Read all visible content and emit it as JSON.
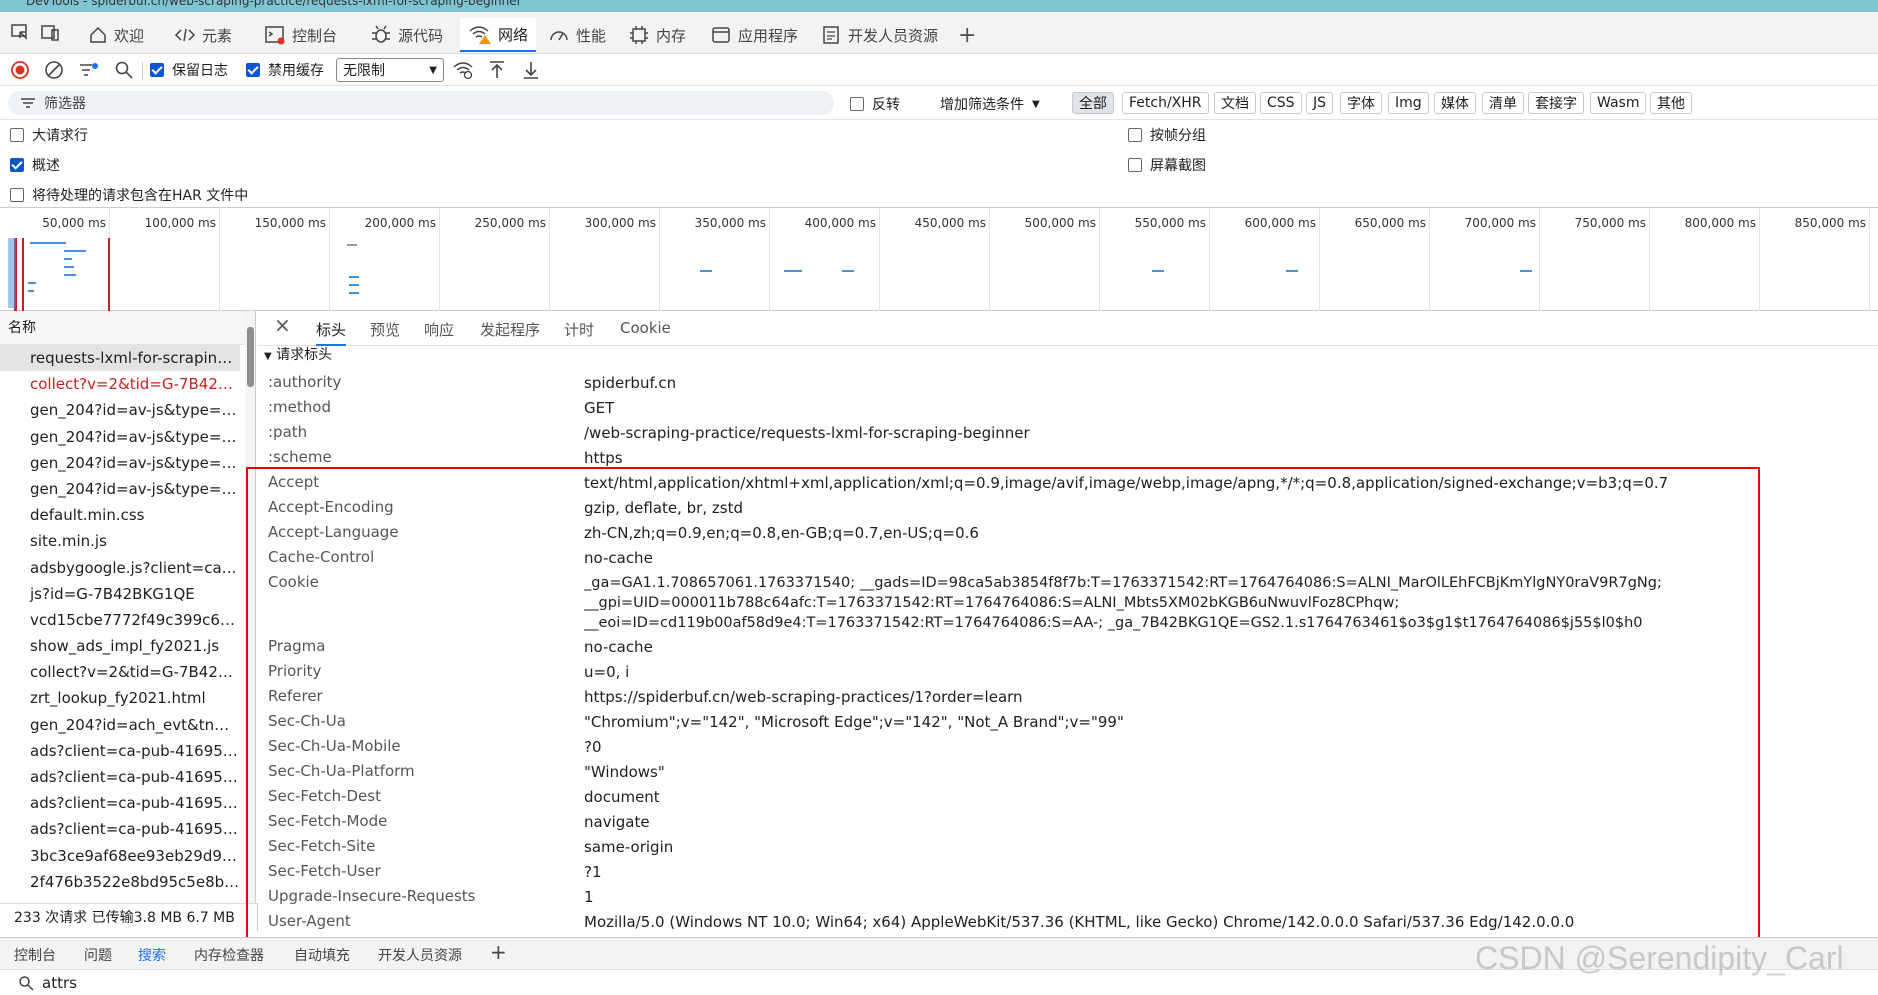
{
  "window": {
    "title": "DevTools - spiderbuf.cn/web-scraping-practice/requests-lxml-for-scraping-beginner"
  },
  "tabs": [
    "欢迎",
    "元素",
    "控制台",
    "源代码",
    "网络",
    "性能",
    "内存",
    "应用程序",
    "开发人员资源"
  ],
  "toolbar": {
    "preserve_log": "保留日志",
    "disable_cache": "禁用缓存",
    "throttle": "无限制"
  },
  "filter": {
    "placeholder": "筛选器",
    "invert": "反转",
    "more_filters": "增加筛选条件",
    "types": [
      "全部",
      "Fetch/XHR",
      "文档",
      "CSS",
      "JS",
      "字体",
      "Img",
      "媒体",
      "清单",
      "套接字",
      "Wasm",
      "其他"
    ]
  },
  "options": {
    "big_rows": "大请求行",
    "overview": "概述",
    "har": "将待处理的请求包含在HAR 文件中",
    "group_frame": "按帧分组",
    "screenshots": "屏幕截图"
  },
  "timeline_ticks": [
    "50,000 ms",
    "100,000 ms",
    "150,000 ms",
    "200,000 ms",
    "250,000 ms",
    "300,000 ms",
    "350,000 ms",
    "400,000 ms",
    "450,000 ms",
    "500,000 ms",
    "550,000 ms",
    "600,000 ms",
    "650,000 ms",
    "700,000 ms",
    "750,000 ms",
    "800,000 ms",
    "850,000 ms"
  ],
  "requests": {
    "header": "名称",
    "items": [
      "requests-lxml-for-scraping...",
      "collect?v=2&tid=G-7B42B...",
      "gen_204?id=av-js&type=fl...",
      "gen_204?id=av-js&type=fl...",
      "gen_204?id=av-js&type=fl...",
      "gen_204?id=av-js&type=fl...",
      "default.min.css",
      "site.min.js",
      "adsbygoogle.js?client=ca-...",
      "js?id=G-7B42BKG1QE",
      "vcd15cbe7772f49c399c6a5...",
      "show_ads_impl_fy2021.js",
      "collect?v=2&tid=G-7B42B...",
      "zrt_lookup_fy2021.html",
      "gen_204?id=ach_evt&tn=...",
      "ads?client=ca-pub-416950...",
      "ads?client=ca-pub-416950...",
      "ads?client=ca-pub-416950...",
      "ads?client=ca-pub-416950...",
      "3bc3ce9af68ee93eb29d97...",
      "2f476b3522e8bd95c5e8ba..."
    ],
    "status": "233 次请求  已传输3.8 MB  6.7 MB"
  },
  "detail": {
    "tabs": [
      "标头",
      "预览",
      "响应",
      "发起程序",
      "计时",
      "Cookie"
    ],
    "section": "请求标头",
    "headers": [
      {
        "k": ":authority",
        "v": "spiderbuf.cn"
      },
      {
        "k": ":method",
        "v": "GET"
      },
      {
        "k": ":path",
        "v": "/web-scraping-practice/requests-lxml-for-scraping-beginner"
      },
      {
        "k": ":scheme",
        "v": "https"
      },
      {
        "k": "Accept",
        "v": "text/html,application/xhtml+xml,application/xml;q=0.9,image/avif,image/webp,image/apng,*/*;q=0.8,application/signed-exchange;v=b3;q=0.7"
      },
      {
        "k": "Accept-Encoding",
        "v": "gzip, deflate, br, zstd"
      },
      {
        "k": "Accept-Language",
        "v": "zh-CN,zh;q=0.9,en;q=0.8,en-GB;q=0.7,en-US;q=0.6"
      },
      {
        "k": "Cache-Control",
        "v": "no-cache"
      },
      {
        "k": "Cookie",
        "v": "_ga=GA1.1.708657061.1763371540; __gads=ID=98ca5ab3854f8f7b:T=1763371542:RT=1764764086:S=ALNI_MarOlLEhFCBjKmYlgNY0raV9R7gNg; __gpi=UID=000011b788c64afc:T=1763371542:RT=1764764086:S=ALNI_Mbts5XM02bKGB6uNwuvlFoz8CPhqw; __eoi=ID=cd119b00af58d9e4:T=1763371542:RT=1764764086:S=AA-; _ga_7B42BKG1QE=GS2.1.s1764763461$o3$g1$t1764764086$j55$l0$h0"
      },
      {
        "k": "Pragma",
        "v": "no-cache"
      },
      {
        "k": "Priority",
        "v": "u=0, i"
      },
      {
        "k": "Referer",
        "v": "https://spiderbuf.cn/web-scraping-practices/1?order=learn"
      },
      {
        "k": "Sec-Ch-Ua",
        "v": "\"Chromium\";v=\"142\", \"Microsoft Edge\";v=\"142\", \"Not_A Brand\";v=\"99\""
      },
      {
        "k": "Sec-Ch-Ua-Mobile",
        "v": "?0"
      },
      {
        "k": "Sec-Ch-Ua-Platform",
        "v": "\"Windows\""
      },
      {
        "k": "Sec-Fetch-Dest",
        "v": "document"
      },
      {
        "k": "Sec-Fetch-Mode",
        "v": "navigate"
      },
      {
        "k": "Sec-Fetch-Site",
        "v": "same-origin"
      },
      {
        "k": "Sec-Fetch-User",
        "v": "?1"
      },
      {
        "k": "Upgrade-Insecure-Requests",
        "v": "1"
      },
      {
        "k": "User-Agent",
        "v": "Mozilla/5.0 (Windows NT 10.0; Win64; x64) AppleWebKit/537.36 (KHTML, like Gecko) Chrome/142.0.0.0 Safari/537.36 Edg/142.0.0.0"
      }
    ]
  },
  "drawer": {
    "tabs": [
      "控制台",
      "问题",
      "搜索",
      "内存检查器",
      "自动填充",
      "开发人员资源"
    ],
    "search_value": "attrs"
  },
  "watermark": "CSDN @Serendipity_Carl"
}
